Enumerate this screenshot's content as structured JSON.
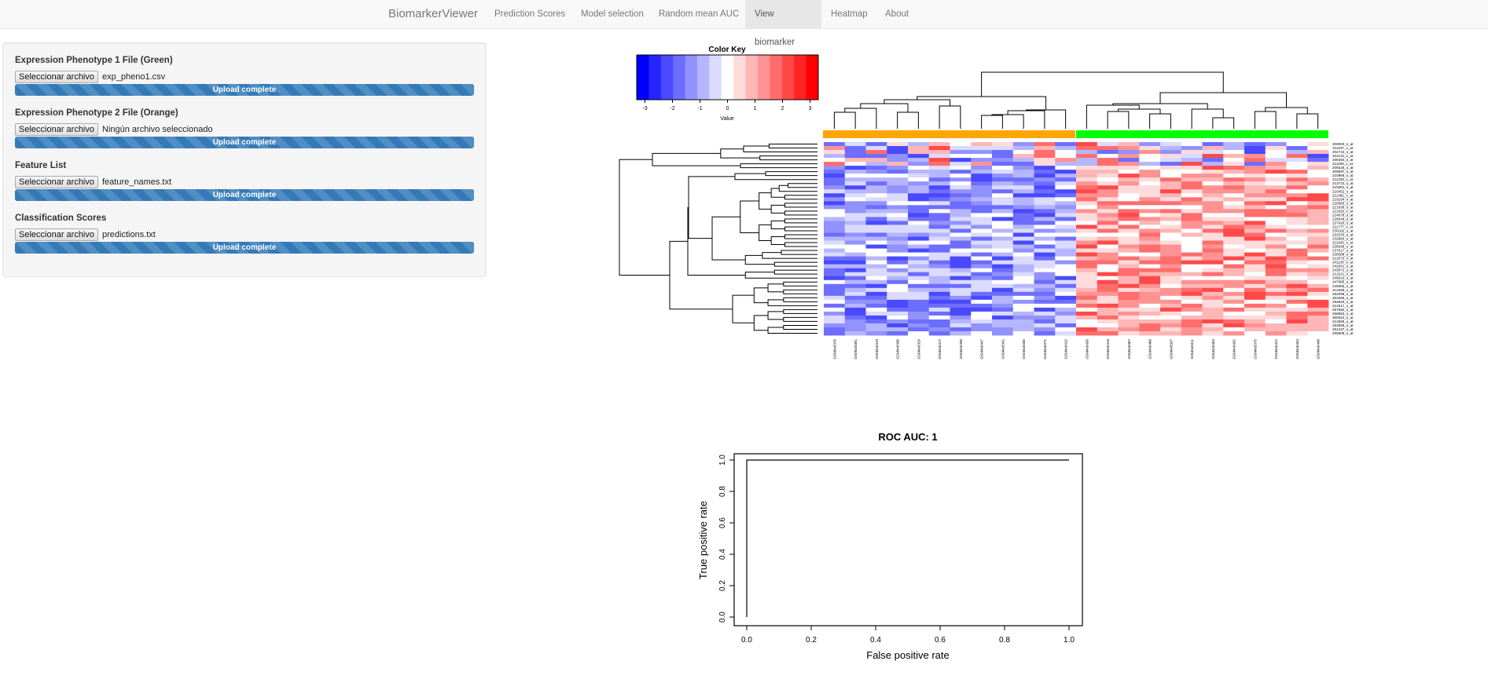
{
  "navbar": {
    "brand": "BiomarkerViewer",
    "items": [
      {
        "label": "Prediction Scores",
        "active": false
      },
      {
        "label": "Model selection",
        "active": false
      },
      {
        "label": "Random mean AUC",
        "active": false
      },
      {
        "label": "View biomarker",
        "active": true
      },
      {
        "label": "Heatmap",
        "active": false
      },
      {
        "label": "About",
        "active": false
      }
    ]
  },
  "upload_panel": {
    "fields": [
      {
        "label": "Expression Phenotype 1 File (Green)",
        "button": "Seleccionar archivo",
        "file": "exp_pheno1.csv",
        "progress_text": "Upload complete",
        "progress": 1.0
      },
      {
        "label": "Expression Phenotype 2 File (Orange)",
        "button": "Seleccionar archivo",
        "file": "Ningún archivo seleccionado",
        "progress_text": "Upload complete",
        "progress": 1.0
      },
      {
        "label": "Feature List",
        "button": "Seleccionar archivo",
        "file": "feature_names.txt",
        "progress_text": "Upload complete",
        "progress": 1.0
      },
      {
        "label": "Classification Scores",
        "button": "Seleccionar archivo",
        "file": "predictions.txt",
        "progress_text": "Upload complete",
        "progress": 1.0
      }
    ]
  },
  "chart_data": [
    {
      "type": "heatmap",
      "title": "",
      "color_key": {
        "title": "Color Key",
        "xlabel": "Value",
        "range": [
          -3.3,
          3.3
        ],
        "ticks": [
          -3,
          -2,
          -1,
          0,
          1,
          2,
          3
        ],
        "tick_labels": [
          "-3",
          "-2",
          "-1",
          "0",
          "1",
          "2",
          "3"
        ],
        "low_color": "#0000ff",
        "mid_color": "#ffffff",
        "high_color": "#ff0000",
        "n_bins": 15
      },
      "column_groups": [
        {
          "name": "Phenotype 2",
          "color": "#ffa500",
          "count": 12
        },
        {
          "name": "Phenotype 1",
          "color": "#00ff00",
          "count": 12
        }
      ],
      "columns": [
        "GSM4x0376",
        "GSM4x0351",
        "GSM4x0419",
        "GSM4x0336",
        "GSM4x0329",
        "GSM4x0417",
        "GSM4x0406",
        "GSM4x0447",
        "GSM4x0342",
        "GSM4x0335",
        "GSM4x0371",
        "GSM4x0410",
        "GSM4x0430",
        "GSM4x0419",
        "GSM4x0367",
        "GSM4x0468",
        "GSM4x0337",
        "GSM4x0411",
        "GSM4x0453",
        "GSM4x0432",
        "GSM4x0375",
        "GSM4x0422",
        "GSM4x0434",
        "GSM4x0448"
      ],
      "n_rows": 49,
      "row_label_suffix": "_at",
      "row_dendrogram": true,
      "column_dendrogram": true,
      "seed": 7
    },
    {
      "type": "line",
      "title": "ROC AUC: 1",
      "xlabel": "False positive rate",
      "ylabel": "True positive rate",
      "xlim": [
        0,
        1
      ],
      "ylim": [
        0,
        1
      ],
      "xticks": [
        0.0,
        0.2,
        0.4,
        0.6,
        0.8,
        1.0
      ],
      "xtick_labels": [
        "0.0",
        "0.2",
        "0.4",
        "0.6",
        "0.8",
        "1.0"
      ],
      "yticks": [
        0.0,
        0.2,
        0.4,
        0.6,
        0.8,
        1.0
      ],
      "ytick_labels": [
        "0.0",
        "0.2",
        "0.4",
        "0.6",
        "0.8",
        "1.0"
      ],
      "grid": false,
      "series": [
        {
          "name": "ROC",
          "x": [
            0,
            0,
            1
          ],
          "y": [
            0,
            1,
            1
          ],
          "color": "#000000"
        }
      ]
    }
  ]
}
